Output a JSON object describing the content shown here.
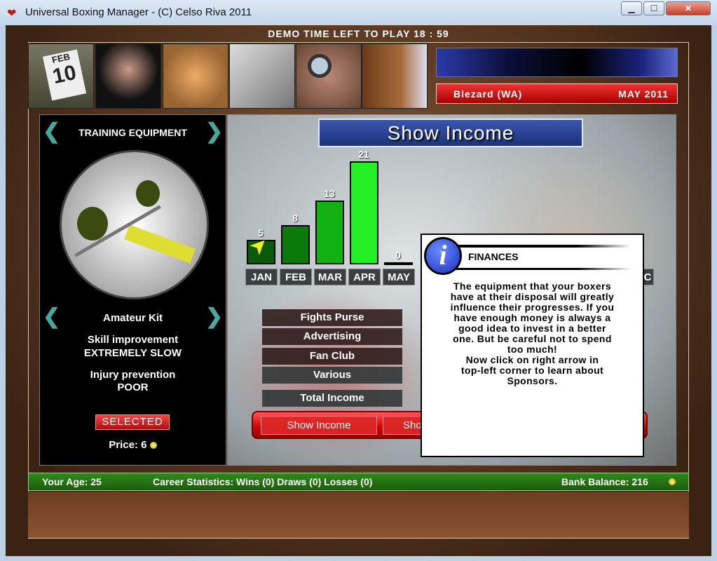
{
  "window": {
    "title": "Universal Boxing Manager - (C) Celso Riva 2011",
    "minimize": "▁",
    "maximize": "☐",
    "close": "✕"
  },
  "demo_text": "DEMO  TIME  LEFT  TO  PLAY  18 : 59",
  "header": {
    "toolbar_icons": [
      "calendar-icon",
      "boxer-icon",
      "coins-icon",
      "documents-icon",
      "magnifier-icon",
      "door-icon"
    ],
    "calendar_month": "FEB",
    "calendar_day": "10",
    "manager": "Blezard  (WA)",
    "date": "MAY  2011"
  },
  "equipment": {
    "title": "TRAINING  EQUIPMENT",
    "name": "Amateur  Kit",
    "skill_label": "Skill  improvement",
    "skill_value": "EXTREMELY  SLOW",
    "injury_label": "Injury  prevention",
    "injury_value": "POOR",
    "selected": "SELECTED",
    "price_label": "Price:",
    "price": "6"
  },
  "chart_data": {
    "type": "bar",
    "title": "Show Income",
    "categories": [
      "JAN",
      "FEB",
      "MAR",
      "APR",
      "MAY"
    ],
    "values": [
      5,
      8,
      13,
      21,
      0
    ],
    "partial_label": "C",
    "colors": [
      "#0a5a0a",
      "#0a7a0a",
      "#12b012",
      "#22f022",
      "#000000"
    ]
  },
  "income_categories": [
    "Fights  Purse",
    "Advertising",
    "Fan  Club",
    "Various"
  ],
  "total_income": "Total  Income",
  "buttons": {
    "show_income": "Show Income",
    "show_other": "Sho"
  },
  "popup": {
    "title": "FINANCES",
    "text": "The  equipment  that  your  boxers\nhave  at  their  disposal  will  greatly\ninfluence  their  progresses.  If  you\nhave  enough  money  is  always  a\ngood  idea  to  invest  in  a  better\none.  But  be  careful  not  to  spend\ntoo  much!\nNow  click  on  right  arrow  in\ntop-left  corner  to  learn  about\nSponsors."
  },
  "status": {
    "age": "Your  Age:  25",
    "career": "Career  Statistics:  Wins  (0)  Draws  (0)  Losses  (0)",
    "bank": "Bank  Balance:  216"
  }
}
